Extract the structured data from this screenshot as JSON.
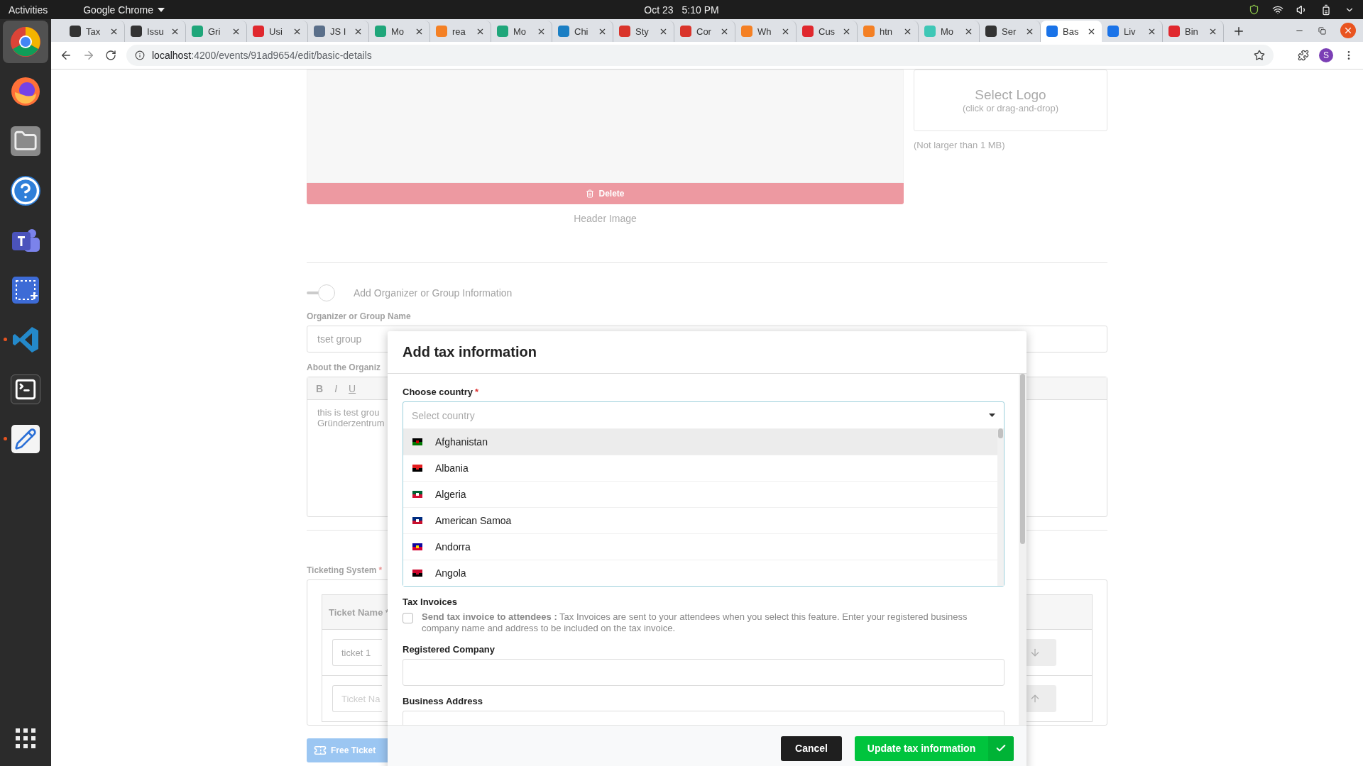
{
  "system_bar": {
    "activities": "Activities",
    "app_name": "Google Chrome",
    "date": "Oct 23",
    "time": "5:10 PM"
  },
  "dock": [
    {
      "kind": "chrome",
      "active": true,
      "running": false
    },
    {
      "kind": "firefox",
      "active": false,
      "running": false
    },
    {
      "kind": "files",
      "active": false,
      "running": false
    },
    {
      "kind": "help",
      "active": false,
      "running": false
    },
    {
      "kind": "teams",
      "active": false,
      "running": false
    },
    {
      "kind": "screenshot",
      "active": false,
      "running": false
    },
    {
      "kind": "vscode",
      "active": false,
      "running": true
    },
    {
      "kind": "terminal",
      "active": false,
      "running": false
    },
    {
      "kind": "editor",
      "active": false,
      "running": true
    }
  ],
  "browser": {
    "tabs": [
      {
        "title": "Tax",
        "selected": false,
        "color": "#333333"
      },
      {
        "title": "Issu",
        "selected": false,
        "color": "#333333"
      },
      {
        "title": "Gri",
        "selected": false,
        "color": "#1fa67a"
      },
      {
        "title": "Usi",
        "selected": false,
        "color": "#e0282e"
      },
      {
        "title": "JS I",
        "selected": false,
        "color": "#5a6f8a"
      },
      {
        "title": "Mo",
        "selected": false,
        "color": "#1fa67a"
      },
      {
        "title": "rea",
        "selected": false,
        "color": "#f48024"
      },
      {
        "title": "Mo",
        "selected": false,
        "color": "#1fa67a"
      },
      {
        "title": "Chi",
        "selected": false,
        "color": "#1b7fc4"
      },
      {
        "title": "Sty",
        "selected": false,
        "color": "#d9342b"
      },
      {
        "title": "Cor",
        "selected": false,
        "color": "#d9342b"
      },
      {
        "title": "Wh",
        "selected": false,
        "color": "#f48024"
      },
      {
        "title": "Cus",
        "selected": false,
        "color": "#e0282e"
      },
      {
        "title": "htn",
        "selected": false,
        "color": "#f48024"
      },
      {
        "title": "Mo",
        "selected": false,
        "color": "#3ec7b6"
      },
      {
        "title": "Ser",
        "selected": false,
        "color": "#333333"
      },
      {
        "title": "Bas",
        "selected": true,
        "color": "#1a73e8"
      },
      {
        "title": "Liv",
        "selected": false,
        "color": "#1a73e8"
      },
      {
        "title": "Bin",
        "selected": false,
        "color": "#e0282e"
      }
    ],
    "address": {
      "host": "localhost",
      "path": ":4200/events/91ad9654/edit/basic-details"
    },
    "profile": "S"
  },
  "background_page": {
    "delete_button": "Delete",
    "header_image_caption": "Header Image",
    "logo": {
      "title": "Select Logo",
      "hint": "(click or drag-and-drop)",
      "note": "(Not larger than 1 MB)"
    },
    "organizer_toggle": {
      "label": "Add Organizer or Group Information",
      "on": false
    },
    "organizer_name": {
      "label": "Organizer or Group Name",
      "value": "tset group"
    },
    "about": {
      "label": "About the Organiz",
      "toolbar": [
        {
          "label": "B",
          "kind": "bold"
        },
        {
          "label": "I",
          "kind": "italic"
        },
        {
          "label": "U",
          "kind": "underline"
        }
      ],
      "text_lines": [
        "this is test grou",
        "Gründerzentrum"
      ]
    },
    "ticketing": {
      "label": "Ticketing System",
      "required_mark": "*",
      "column": "Ticket Name *",
      "rows": [
        {
          "value": "ticket 1"
        },
        {
          "placeholder": "Ticket Na"
        }
      ],
      "free_ticket": "Free Ticket"
    }
  },
  "modal": {
    "title": "Add tax information",
    "country": {
      "label": "Choose country",
      "required_mark": "*",
      "placeholder": "Select country",
      "open": true,
      "options": [
        {
          "name": "Afghanistan",
          "highlighted": true
        },
        {
          "name": "Albania",
          "highlighted": false
        },
        {
          "name": "Algeria",
          "highlighted": false
        },
        {
          "name": "American Samoa",
          "highlighted": false
        },
        {
          "name": "Andorra",
          "highlighted": false
        },
        {
          "name": "Angola",
          "highlighted": false
        }
      ]
    },
    "tax_invoices": {
      "heading": "Tax Invoices",
      "checked": false,
      "text": "**Send tax invoice to attendees :** Tax Invoices are sent to your attendees when you select this feature. Enter your registered business company name and address to be included on the tax invoice."
    },
    "registered_company": {
      "label": "Registered Company"
    },
    "business_address": {
      "label": "Business Address"
    },
    "buttons": {
      "cancel": "Cancel",
      "submit": "Update tax information"
    }
  }
}
